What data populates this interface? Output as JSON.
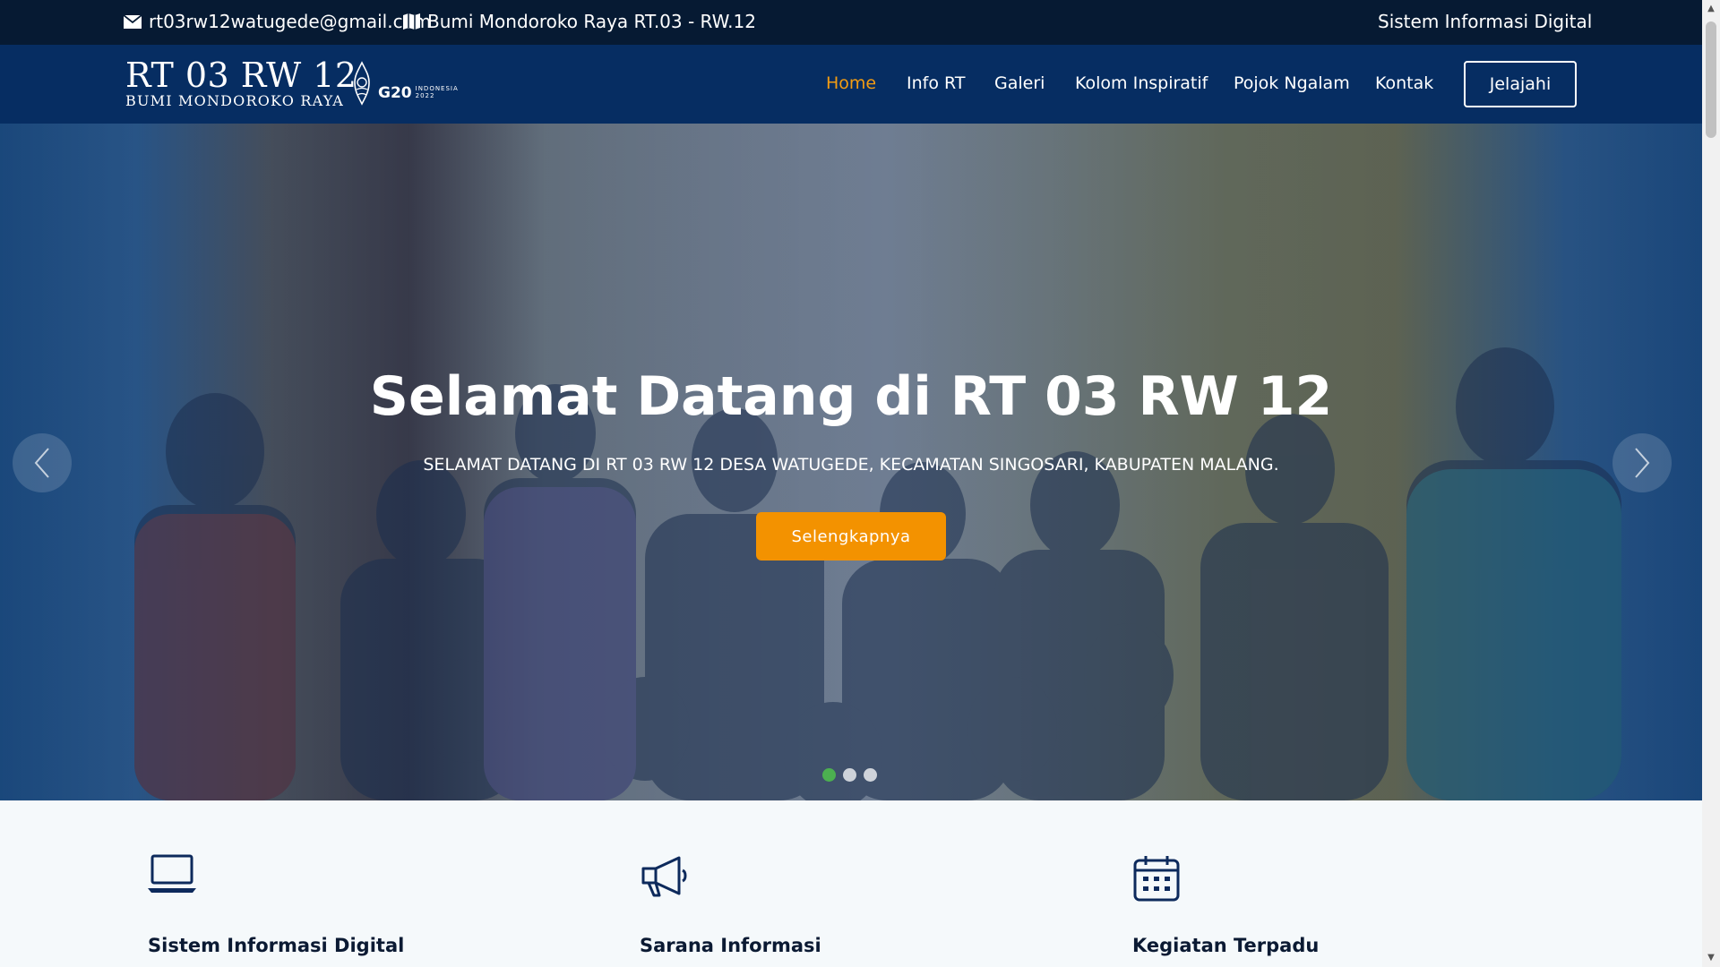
{
  "topbar": {
    "email": "rt03rw12watugede@gmail.com",
    "address": "Bumi Mondoroko Raya RT.03 - RW.12",
    "right_text": "Sistem Informasi Digital"
  },
  "logo": {
    "line1": "RT 03 RW 12",
    "line2": "Bumi Mondoroko Raya",
    "g20_text": "G20",
    "g20_sub1": "INDONESIA",
    "g20_sub2": "2022"
  },
  "nav": {
    "items": [
      "Home",
      "Info RT",
      "Galeri",
      "Kolom Inspiratif",
      "Pojok Ngalam",
      "Kontak"
    ],
    "active": "Home",
    "cta": "Jelajahi",
    "accent_color": "#f39c12"
  },
  "hero": {
    "title": "Selamat Datang di RT 03 RW 12",
    "subtitle": "SELAMAT DATANG DI RT 03 RW 12 DESA WATUGEDE, KECAMATAN SINGOSARI, KABUPATEN MALANG.",
    "button": "Selengkapnya",
    "button_color": "#f39200",
    "slide_count": 3,
    "active_slide": 1
  },
  "features": [
    {
      "icon": "laptop-icon",
      "title": "Sistem Informasi Digital"
    },
    {
      "icon": "megaphone-icon",
      "title": "Sarana Informasi"
    },
    {
      "icon": "calendar-icon",
      "title": "Kegiatan Terpadu"
    }
  ],
  "colors": {
    "topbar_bg": "#061a33",
    "header_bg": "#062d62",
    "feature_icon": "#0d2a5c"
  }
}
